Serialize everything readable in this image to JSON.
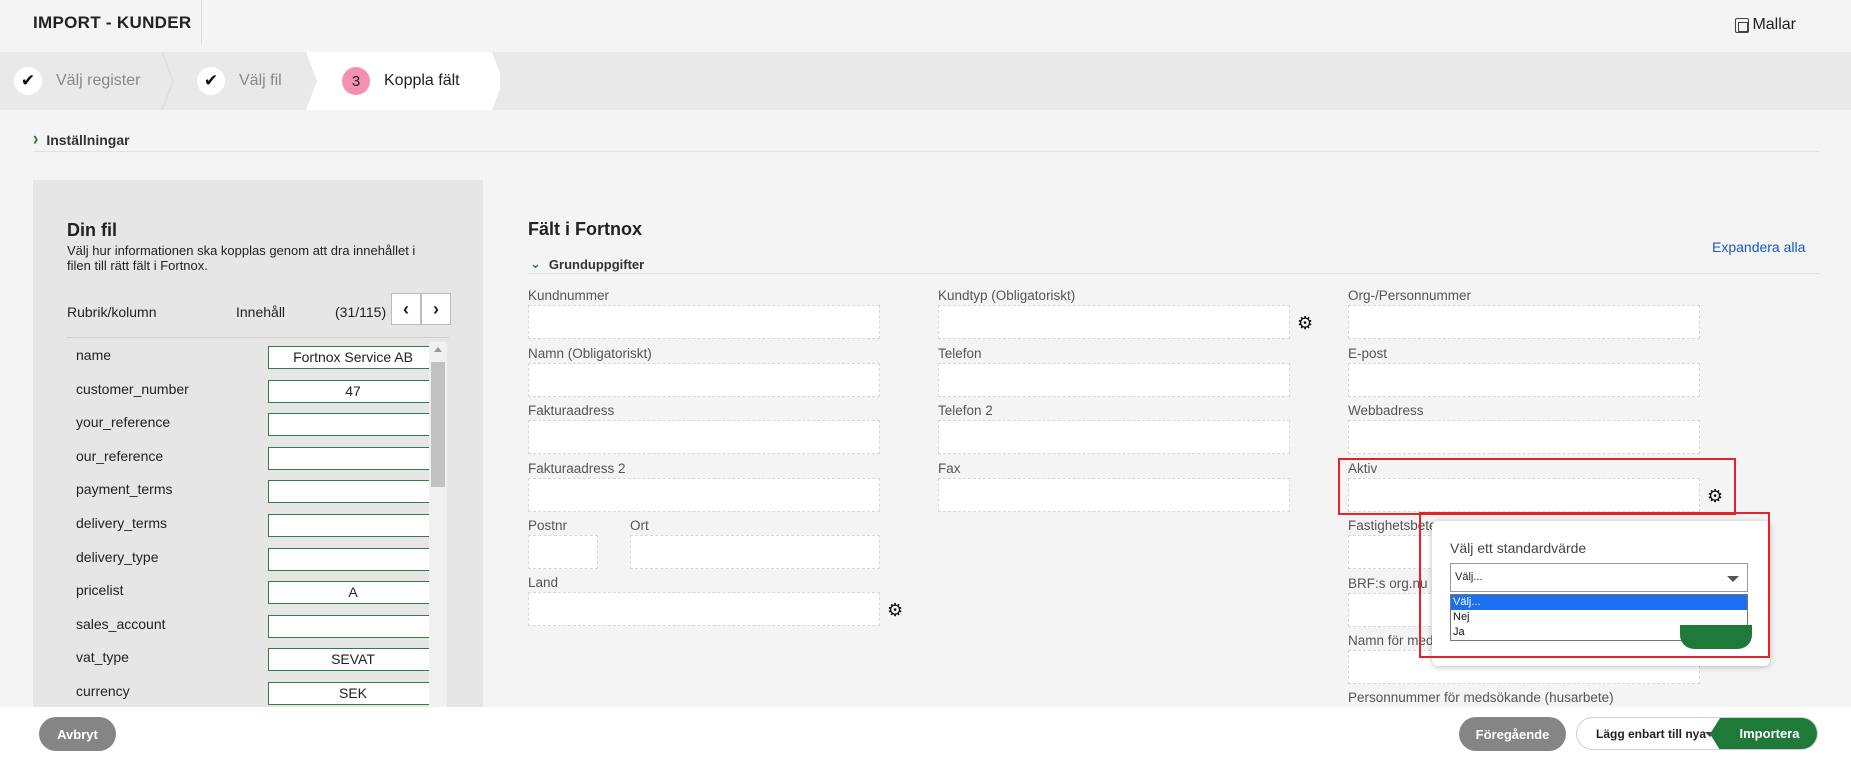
{
  "app": {
    "title": "IMPORT - KUNDER",
    "templates_label": "Mallar"
  },
  "steps": [
    {
      "label": "Välj register",
      "marker": "✔"
    },
    {
      "label": "Välj fil",
      "marker": "✔"
    },
    {
      "label": "Koppla fält",
      "marker": "3"
    }
  ],
  "settings": {
    "label": "Inställningar"
  },
  "file_panel": {
    "title": "Din fil",
    "description": "Välj hur informationen ska kopplas genom att dra innehållet i filen till rätt fält i Fortnox.",
    "col_header": "Rubrik/kolumn",
    "content_header": "Innehåll",
    "count": "(31/115)",
    "rows": [
      {
        "name": "name",
        "value": "Fortnox Service AB"
      },
      {
        "name": "customer_number",
        "value": "47"
      },
      {
        "name": "your_reference",
        "value": ""
      },
      {
        "name": "our_reference",
        "value": ""
      },
      {
        "name": "payment_terms",
        "value": ""
      },
      {
        "name": "delivery_terms",
        "value": ""
      },
      {
        "name": "delivery_type",
        "value": ""
      },
      {
        "name": "pricelist",
        "value": "A"
      },
      {
        "name": "sales_account",
        "value": ""
      },
      {
        "name": "vat_type",
        "value": "SEVAT"
      },
      {
        "name": "currency",
        "value": "SEK"
      }
    ]
  },
  "fortnox": {
    "title": "Fält i Fortnox",
    "expand_all": "Expandera alla",
    "section": "Grunduppgifter",
    "fields": {
      "kundnummer": "Kundnummer",
      "kundtyp": "Kundtyp (Obligatoriskt)",
      "orgnr": "Org-/Personnummer",
      "namn": "Namn (Obligatoriskt)",
      "telefon": "Telefon",
      "epost": "E-post",
      "fakturaadress": "Fakturaadress",
      "telefon2": "Telefon 2",
      "webbadress": "Webbadress",
      "fakturaadress2": "Fakturaadress 2",
      "fax": "Fax",
      "aktiv": "Aktiv",
      "postnr": "Postnr",
      "ort": "Ort",
      "land": "Land",
      "fastighet": "Fastighetsbete",
      "brf": "BRF:s org.nu",
      "namn_med": "Namn för med",
      "personnr_med": "Personnummer för medsökande (husarbete)"
    }
  },
  "default_popover": {
    "title": "Välj ett standardvärde",
    "selected": "Välj...",
    "options": [
      "Välj...",
      "Nej",
      "Ja"
    ]
  },
  "footer": {
    "cancel": "Avbryt",
    "previous": "Föregående",
    "mode": "Lägg enbart till nya",
    "import": "Importera"
  }
}
